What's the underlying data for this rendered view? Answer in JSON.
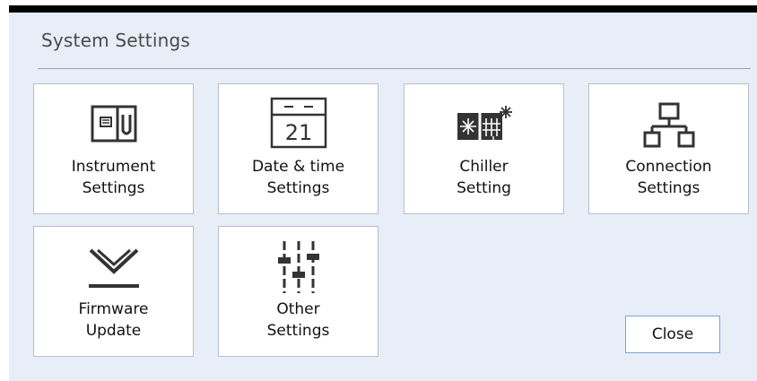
{
  "dialog": {
    "title": "System Settings"
  },
  "tiles": [
    {
      "line1": "Instrument",
      "line2": "Settings",
      "icon": "instrument-icon"
    },
    {
      "line1": "Date & time",
      "line2": "Settings",
      "icon": "calendar-icon",
      "icon_text": "21"
    },
    {
      "line1": "Chiller",
      "line2": "Setting",
      "icon": "chiller-icon"
    },
    {
      "line1": "Connection",
      "line2": "Settings",
      "icon": "network-icon"
    },
    {
      "line1": "Firmware",
      "line2": "Update",
      "icon": "firmware-download-icon"
    },
    {
      "line1": "Other",
      "line2": "Settings",
      "icon": "sliders-icon"
    }
  ],
  "close_button": {
    "label": "Close"
  },
  "colors": {
    "panel_bg": "#e7eef7",
    "tile_border": "#b9bec4",
    "button_border": "#7da6cf",
    "icon_color": "#333333"
  }
}
